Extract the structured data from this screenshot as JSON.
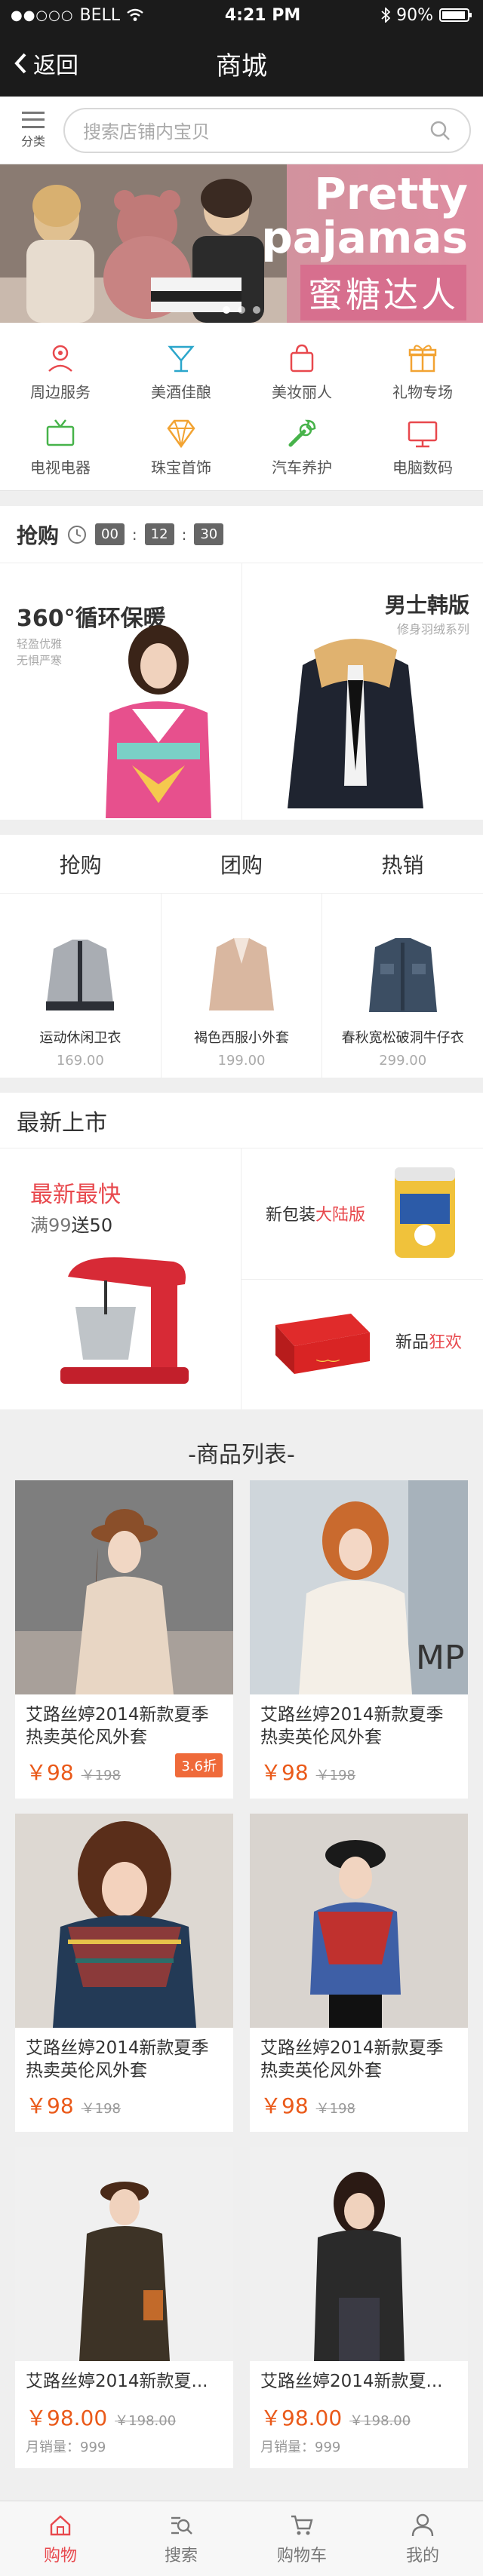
{
  "status": {
    "carrier": "BELL",
    "time": "4:21 PM",
    "battery": "90%"
  },
  "nav": {
    "back_label": "返回",
    "title": "商城"
  },
  "search": {
    "category_label": "分类",
    "placeholder": "搜索店铺内宝贝"
  },
  "banner": {
    "title_line1": "Pretty",
    "title_line2": "pajamas",
    "subtitle": "蜜糖达人",
    "pages": 3,
    "active_page": 0
  },
  "categories": [
    {
      "label": "周边服务",
      "icon": "location-icon",
      "color": "#e8484d"
    },
    {
      "label": "美酒佳酿",
      "icon": "cocktail-icon",
      "color": "#2ba6cb"
    },
    {
      "label": "美妆丽人",
      "icon": "bag-icon",
      "color": "#e8484d"
    },
    {
      "label": "礼物专场",
      "icon": "gift-icon",
      "color": "#f2a332"
    },
    {
      "label": "电视电器",
      "icon": "tv-icon",
      "color": "#47b34a"
    },
    {
      "label": "珠宝首饰",
      "icon": "diamond-icon",
      "color": "#f2a332"
    },
    {
      "label": "汽车养护",
      "icon": "wrench-icon",
      "color": "#47b34a"
    },
    {
      "label": "电脑数码",
      "icon": "monitor-icon",
      "color": "#e8484d"
    }
  ],
  "flash": {
    "title": "抢购",
    "countdown": {
      "h": "00",
      "m": "12",
      "s": "30"
    },
    "left": {
      "title": "360°循环保暖",
      "sub1": "轻盈优雅",
      "sub2": "无惧严寒"
    },
    "right": {
      "title": "男士韩版",
      "sub": "修身羽绒系列"
    }
  },
  "tabs": {
    "headers": [
      "抢购",
      "团购",
      "热销"
    ],
    "products": [
      {
        "name": "运动休闲卫衣",
        "price": "169.00"
      },
      {
        "name": "褐色西服小外套",
        "price": "199.00"
      },
      {
        "name": "春秋宽松破洞牛仔衣",
        "price": "299.00"
      }
    ]
  },
  "new_arrivals": {
    "title": "最新上市",
    "left": {
      "title": "最新最快",
      "promo_a": "满99",
      "promo_b": "送50"
    },
    "right_top": {
      "prefix": "新包装",
      "highlight": "大陆版"
    },
    "right_bottom": {
      "prefix": "新品",
      "highlight": "狂欢"
    }
  },
  "product_list": {
    "title": "-商品列表-",
    "items": [
      {
        "name": "艾路丝婷2014新款夏季热卖英伦风外套",
        "price": "￥98",
        "old": "￥198",
        "discount": "3.6折"
      },
      {
        "name": "艾路丝婷2014新款夏季热卖英伦风外套",
        "price": "￥98",
        "old": "￥198",
        "discount": ""
      },
      {
        "name": "艾路丝婷2014新款夏季热卖英伦风外套",
        "price": "￥98",
        "old": "￥198",
        "discount": ""
      },
      {
        "name": "艾路丝婷2014新款夏季热卖英伦风外套",
        "price": "￥98",
        "old": "￥198",
        "discount": ""
      }
    ],
    "items2": [
      {
        "name": "艾路丝婷2014新款夏...",
        "price": "￥98.00",
        "old": "￥198.00",
        "sales": "月销量：999"
      },
      {
        "name": "艾路丝婷2014新款夏...",
        "price": "￥98.00",
        "old": "￥198.00",
        "sales": "月销量：999"
      }
    ]
  },
  "tabbar": [
    {
      "label": "购物",
      "icon": "home-icon",
      "active": true
    },
    {
      "label": "搜索",
      "icon": "search-icon",
      "active": false
    },
    {
      "label": "购物车",
      "icon": "cart-icon",
      "active": false
    },
    {
      "label": "我的",
      "icon": "user-icon",
      "active": false
    }
  ]
}
